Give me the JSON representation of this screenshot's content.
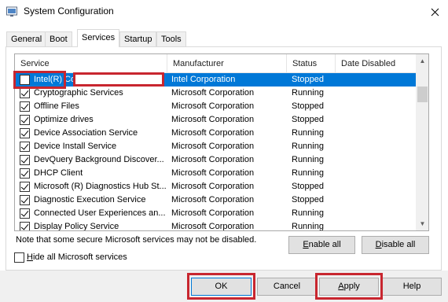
{
  "window": {
    "title": "System Configuration",
    "icon": "system-config-icon",
    "close_icon": "close-icon"
  },
  "tabs": [
    {
      "label": "General",
      "active": false
    },
    {
      "label": "Boot",
      "active": false
    },
    {
      "label": "Services",
      "active": true
    },
    {
      "label": "Startup",
      "active": false
    },
    {
      "label": "Tools",
      "active": false
    }
  ],
  "table": {
    "columns": [
      "Service",
      "Manufacturer",
      "Status",
      "Date Disabled"
    ],
    "rows": [
      {
        "service": "Intel(R) Co",
        "manufacturer": "Intel Corporation",
        "status": "Stopped",
        "checked": false,
        "selected": true
      },
      {
        "service": "Cryptographic Services",
        "manufacturer": "Microsoft Corporation",
        "status": "Running",
        "checked": true,
        "selected": false
      },
      {
        "service": "Offline Files",
        "manufacturer": "Microsoft Corporation",
        "status": "Stopped",
        "checked": true,
        "selected": false
      },
      {
        "service": "Optimize drives",
        "manufacturer": "Microsoft Corporation",
        "status": "Stopped",
        "checked": true,
        "selected": false
      },
      {
        "service": "Device Association Service",
        "manufacturer": "Microsoft Corporation",
        "status": "Running",
        "checked": true,
        "selected": false
      },
      {
        "service": "Device Install Service",
        "manufacturer": "Microsoft Corporation",
        "status": "Running",
        "checked": true,
        "selected": false
      },
      {
        "service": "DevQuery Background Discover...",
        "manufacturer": "Microsoft Corporation",
        "status": "Running",
        "checked": true,
        "selected": false
      },
      {
        "service": "DHCP Client",
        "manufacturer": "Microsoft Corporation",
        "status": "Running",
        "checked": true,
        "selected": false
      },
      {
        "service": "Microsoft (R) Diagnostics Hub St...",
        "manufacturer": "Microsoft Corporation",
        "status": "Stopped",
        "checked": true,
        "selected": false
      },
      {
        "service": "Diagnostic Execution Service",
        "manufacturer": "Microsoft Corporation",
        "status": "Stopped",
        "checked": true,
        "selected": false
      },
      {
        "service": "Connected User Experiences an...",
        "manufacturer": "Microsoft Corporation",
        "status": "Running",
        "checked": true,
        "selected": false
      },
      {
        "service": "Display Policy Service",
        "manufacturer": "Microsoft Corporation",
        "status": "Running",
        "checked": true,
        "selected": false
      }
    ]
  },
  "note": "Note that some secure Microsoft services may not be disabled.",
  "enable_all": {
    "pre": "",
    "key": "E",
    "post": "nable all"
  },
  "disable_all": {
    "pre": "",
    "key": "D",
    "post": "isable all"
  },
  "hide_ms": {
    "pre": "",
    "key": "H",
    "post": "ide all Microsoft services",
    "checked": false
  },
  "buttons": {
    "ok": "OK",
    "cancel": "Cancel",
    "apply": {
      "pre": "",
      "key": "A",
      "post": "pply"
    },
    "help": "Help"
  },
  "colors": {
    "highlight_box": "#c8262f",
    "selection": "#0078d7"
  }
}
